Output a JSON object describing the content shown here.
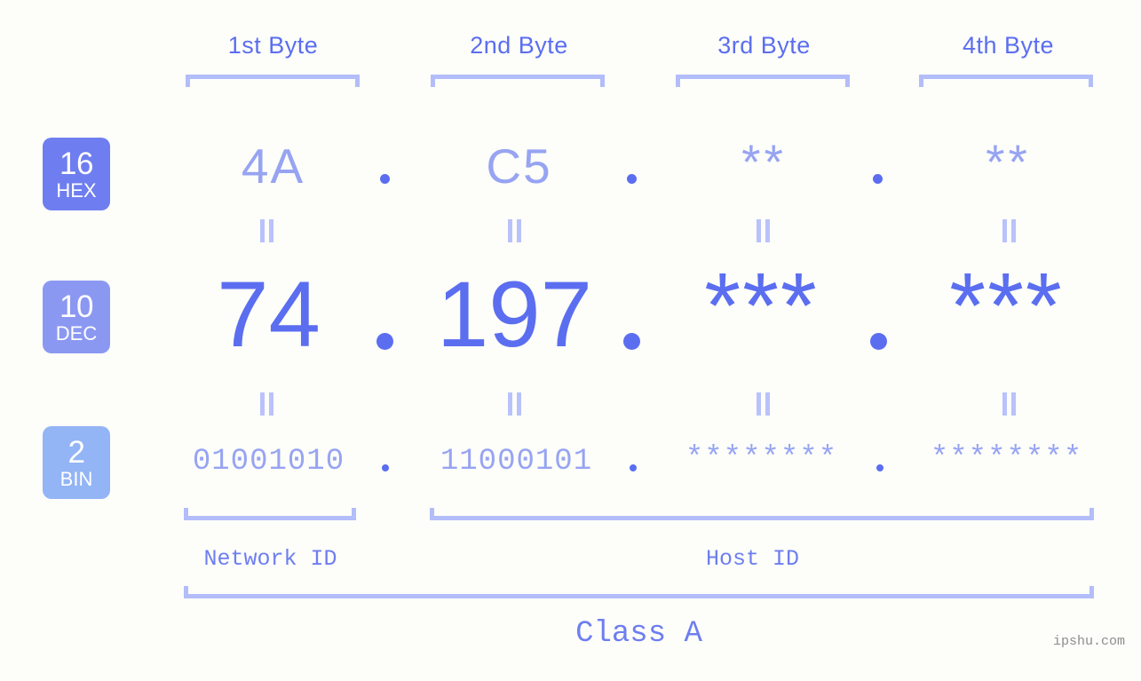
{
  "background_color": "#fdfefa",
  "accent_strong": "#5b6ef0",
  "accent_light": "#97a4f2",
  "bracket_color": "#b3bdfa",
  "byte_headers": [
    {
      "label": "1st Byte"
    },
    {
      "label": "2nd Byte"
    },
    {
      "label": "3rd Byte"
    },
    {
      "label": "4th Byte"
    }
  ],
  "rows": {
    "hex": {
      "badge_number": "16",
      "badge_label": "HEX",
      "badge_color": "#6e7ef0",
      "values": [
        "4A",
        "C5",
        "**",
        "**"
      ]
    },
    "dec": {
      "badge_number": "10",
      "badge_label": "DEC",
      "badge_color": "#8b98f2",
      "values": [
        "74",
        "197",
        "***",
        "***"
      ]
    },
    "bin": {
      "badge_number": "2",
      "badge_label": "BIN",
      "badge_color": "#93b4f5",
      "values": [
        "01001010",
        "11000101",
        "********",
        "********"
      ]
    }
  },
  "separator": ".",
  "equals_symbol": "=",
  "footer": {
    "network_id_label": "Network ID",
    "host_id_label": "Host ID",
    "class_label": "Class A"
  },
  "watermark": "ipshu.com"
}
